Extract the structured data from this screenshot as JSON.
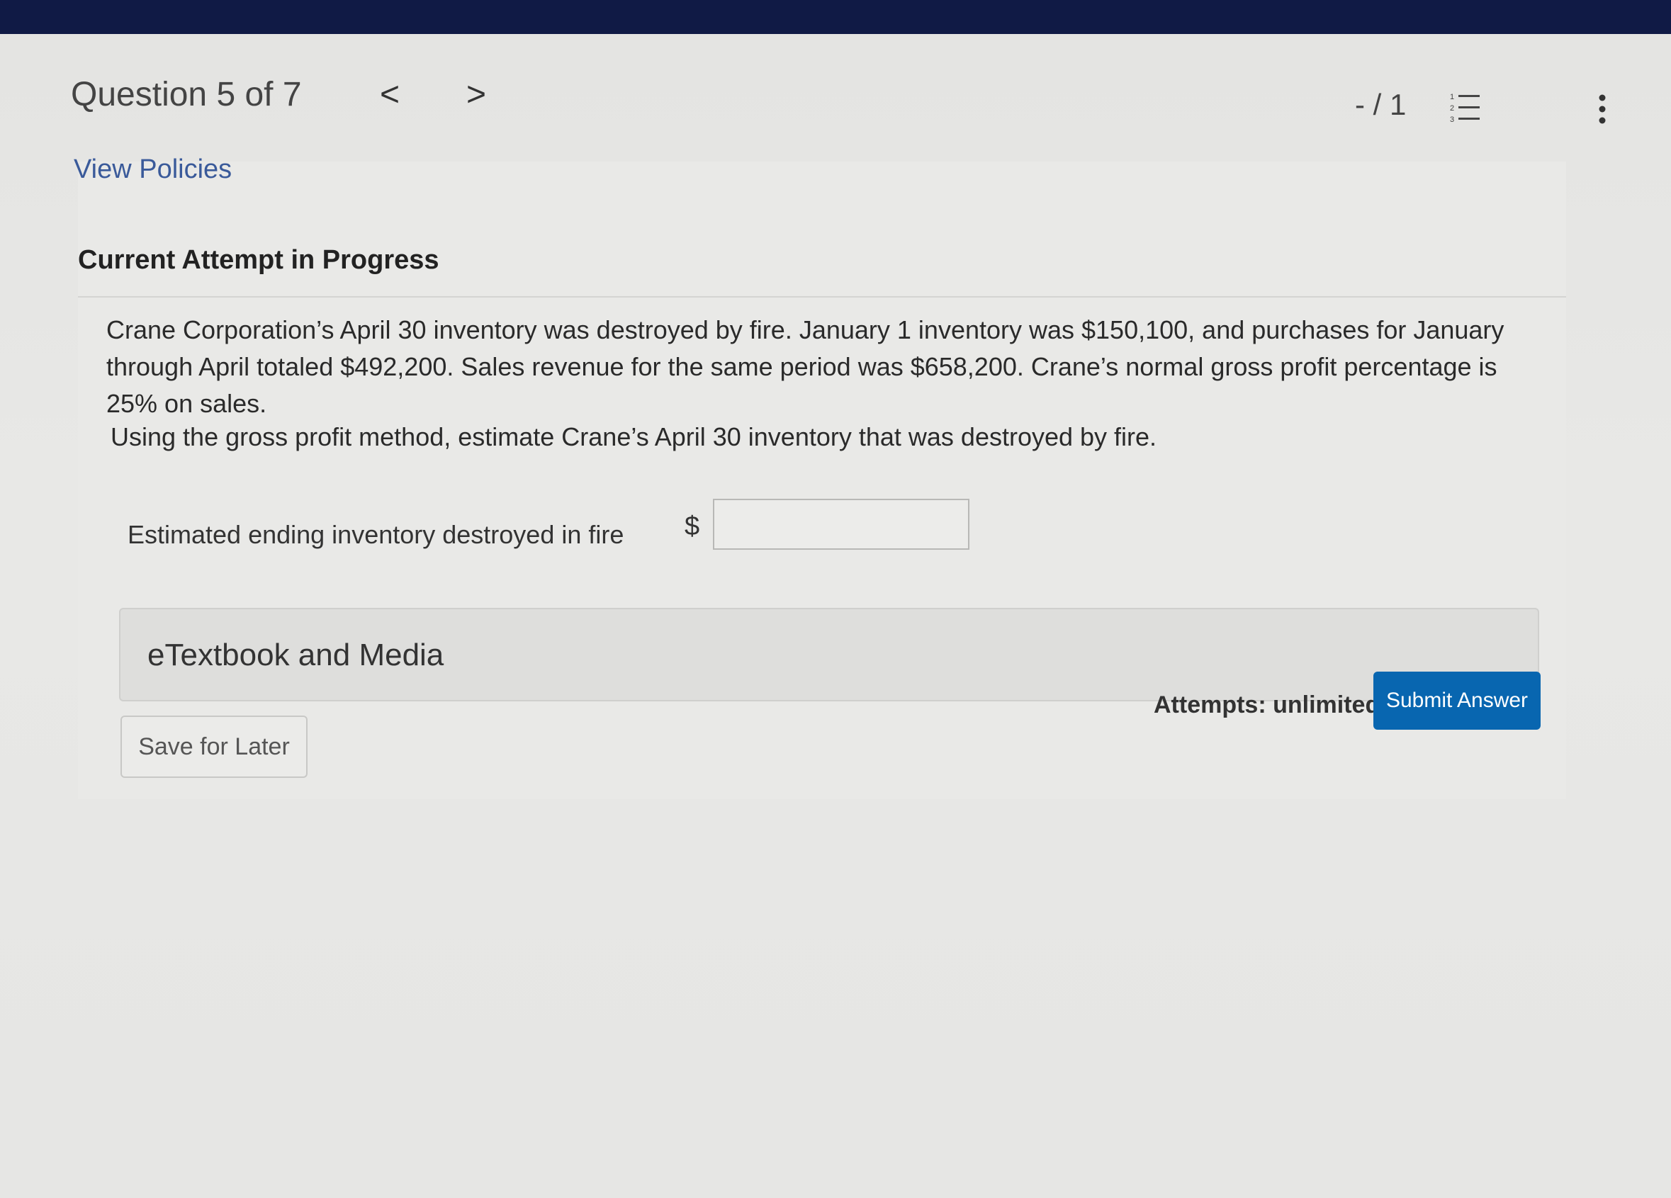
{
  "header": {
    "question_label": "Question 5 of 7",
    "prev_glyph": "<",
    "next_glyph": ">",
    "score": "- / 1",
    "list_icon": "numbered-list-icon",
    "menu_icon": "kebab-menu-icon"
  },
  "policies_link": "View Policies",
  "attempt": {
    "heading": "Current Attempt in Progress"
  },
  "question": {
    "problem_text": "Crane Corporation’s April 30 inventory was destroyed by fire. January 1 inventory was $150,100, and purchases for January through April totaled $492,200. Sales revenue for the same period was $658,200. Crane’s normal gross profit percentage is 25% on sales.",
    "instruction": "Using the gross profit method, estimate Crane’s April 30 inventory that was destroyed by fire.",
    "answer_label": "Estimated ending inventory destroyed in fire",
    "currency_symbol": "$",
    "answer_value": ""
  },
  "resources": {
    "etextbook_label": "eTextbook and Media"
  },
  "footer": {
    "save_label": "Save for Later",
    "attempts_text": "Attempts: unlimited",
    "submit_label": "Submit Answer"
  },
  "colors": {
    "top_bar": "#101a45",
    "link": "#3a5a9a",
    "submit": "#0866b0"
  }
}
